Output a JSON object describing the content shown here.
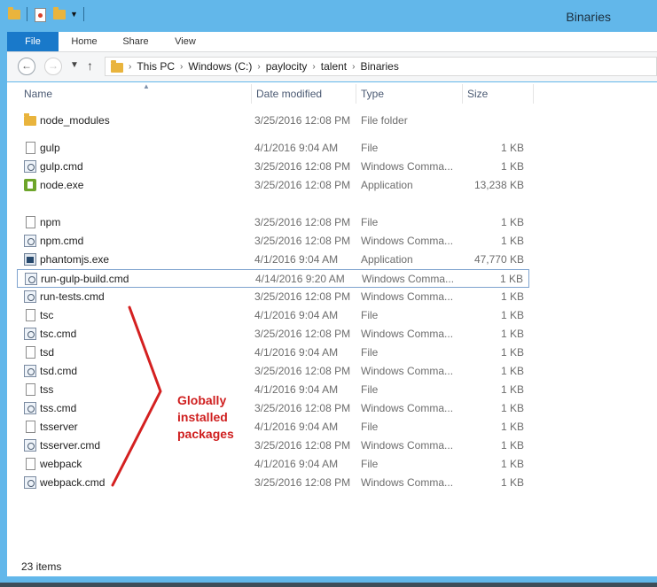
{
  "window": {
    "title": "Binaries"
  },
  "ribbon": {
    "tabs": [
      "File",
      "Home",
      "Share",
      "View"
    ]
  },
  "address": {
    "crumbs": [
      "This PC",
      "Windows (C:)",
      "paylocity",
      "talent",
      "Binaries"
    ]
  },
  "columns": {
    "name": "Name",
    "date": "Date modified",
    "type": "Type",
    "size": "Size"
  },
  "files": [
    {
      "name": "node_modules",
      "date": "3/25/2016 12:08 PM",
      "type": "File folder",
      "size": "",
      "icon": "folder-icon"
    },
    {
      "name": "gulp",
      "date": "4/1/2016 9:04 AM",
      "type": "File",
      "size": "1 KB",
      "icon": "file-icon"
    },
    {
      "name": "gulp.cmd",
      "date": "3/25/2016 12:08 PM",
      "type": "Windows Comma...",
      "size": "1 KB",
      "icon": "cmd-icon"
    },
    {
      "name": "node.exe",
      "date": "3/25/2016 12:08 PM",
      "type": "Application",
      "size": "13,238 KB",
      "icon": "node-icon"
    },
    {
      "name": "npm",
      "date": "3/25/2016 12:08 PM",
      "type": "File",
      "size": "1 KB",
      "icon": "file-icon"
    },
    {
      "name": "npm.cmd",
      "date": "3/25/2016 12:08 PM",
      "type": "Windows Comma...",
      "size": "1 KB",
      "icon": "cmd-icon"
    },
    {
      "name": "phantomjs.exe",
      "date": "4/1/2016 9:04 AM",
      "type": "Application",
      "size": "47,770 KB",
      "icon": "app-icon"
    },
    {
      "name": "run-gulp-build.cmd",
      "date": "4/14/2016 9:20 AM",
      "type": "Windows Comma...",
      "size": "1 KB",
      "icon": "cmd-icon",
      "selected": true
    },
    {
      "name": "run-tests.cmd",
      "date": "3/25/2016 12:08 PM",
      "type": "Windows Comma...",
      "size": "1 KB",
      "icon": "cmd-icon"
    },
    {
      "name": "tsc",
      "date": "4/1/2016 9:04 AM",
      "type": "File",
      "size": "1 KB",
      "icon": "file-icon"
    },
    {
      "name": "tsc.cmd",
      "date": "3/25/2016 12:08 PM",
      "type": "Windows Comma...",
      "size": "1 KB",
      "icon": "cmd-icon"
    },
    {
      "name": "tsd",
      "date": "4/1/2016 9:04 AM",
      "type": "File",
      "size": "1 KB",
      "icon": "file-icon"
    },
    {
      "name": "tsd.cmd",
      "date": "3/25/2016 12:08 PM",
      "type": "Windows Comma...",
      "size": "1 KB",
      "icon": "cmd-icon"
    },
    {
      "name": "tss",
      "date": "4/1/2016 9:04 AM",
      "type": "File",
      "size": "1 KB",
      "icon": "file-icon"
    },
    {
      "name": "tss.cmd",
      "date": "3/25/2016 12:08 PM",
      "type": "Windows Comma...",
      "size": "1 KB",
      "icon": "cmd-icon"
    },
    {
      "name": "tsserver",
      "date": "4/1/2016 9:04 AM",
      "type": "File",
      "size": "1 KB",
      "icon": "file-icon"
    },
    {
      "name": "tsserver.cmd",
      "date": "3/25/2016 12:08 PM",
      "type": "Windows Comma...",
      "size": "1 KB",
      "icon": "cmd-icon"
    },
    {
      "name": "webpack",
      "date": "4/1/2016 9:04 AM",
      "type": "File",
      "size": "1 KB",
      "icon": "file-icon"
    },
    {
      "name": "webpack.cmd",
      "date": "3/25/2016 12:08 PM",
      "type": "Windows Comma...",
      "size": "1 KB",
      "icon": "cmd-icon"
    }
  ],
  "status": {
    "count": "23 items"
  },
  "annotation": {
    "lines": [
      "Globally",
      "installed",
      "packages"
    ],
    "color": "#cf1f1f"
  },
  "colors": {
    "titlebar": "#62b7ea",
    "file_tab": "#1979ca"
  }
}
